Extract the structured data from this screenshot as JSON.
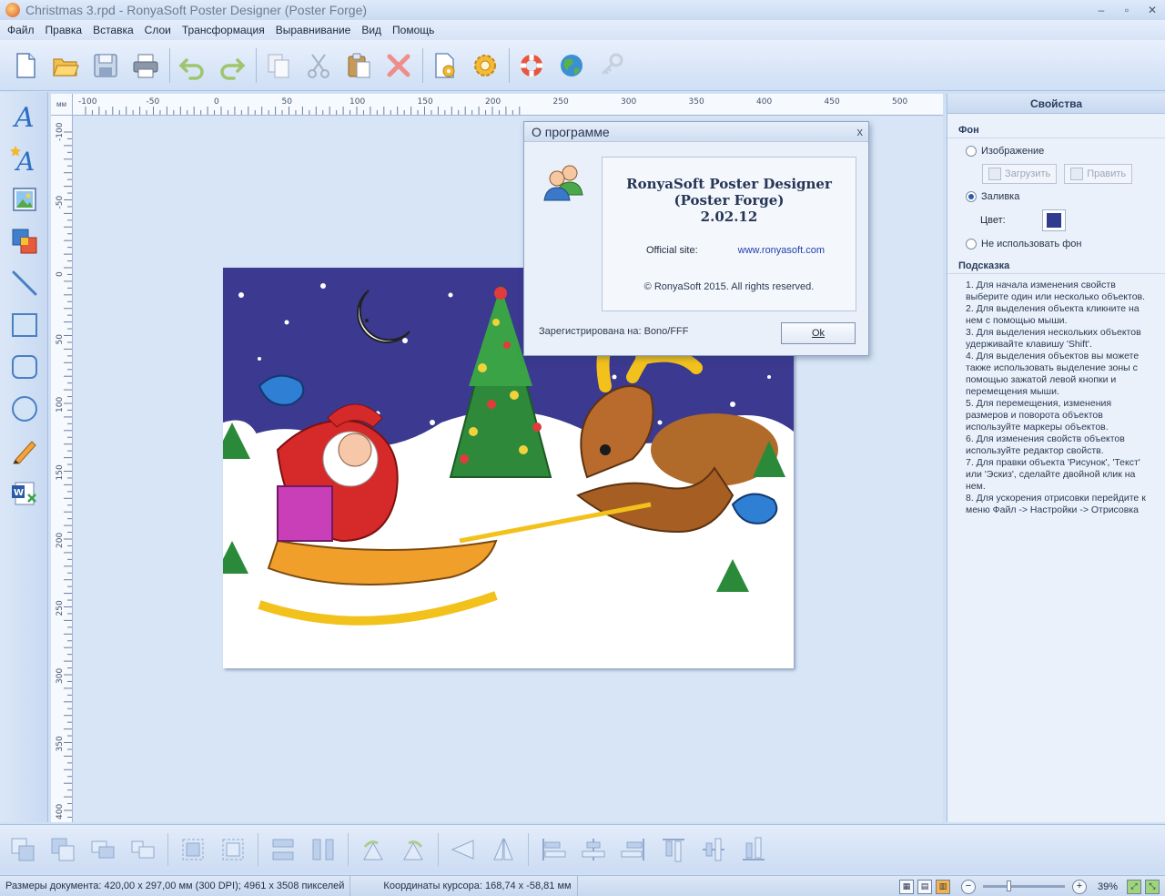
{
  "window": {
    "title": "Christmas 3.rpd - RonyaSoft Poster Designer (Poster Forge)",
    "min_glyph": "–",
    "max_glyph": "▫",
    "close_glyph": "✕"
  },
  "menu": [
    "Файл",
    "Правка",
    "Вставка",
    "Слои",
    "Трансформация",
    "Выравнивание",
    "Вид",
    "Помощь"
  ],
  "toolbar_icons": [
    "new-document-icon",
    "open-folder-icon",
    "save-icon",
    "print-icon",
    "undo-icon",
    "redo-icon",
    "copy-icon",
    "cut-icon",
    "paste-icon",
    "delete-icon",
    "page-settings-icon",
    "settings-gear-icon",
    "help-lifebuoy-icon",
    "website-globe-icon",
    "register-key-icon"
  ],
  "left_tools": [
    "text-icon",
    "curved-text-icon",
    "image-icon",
    "clipart-icon",
    "line-icon",
    "rectangle-icon",
    "rounded-rectangle-icon",
    "ellipse-icon",
    "pencil-icon",
    "word-document-icon"
  ],
  "ruler": {
    "unit": "мм",
    "top_labels": [
      "-100",
      "-50",
      "0",
      "50",
      "100",
      "150",
      "200",
      "250",
      "300",
      "350",
      "400",
      "450",
      "500"
    ],
    "left_labels": [
      "-100",
      "-50",
      "0",
      "50",
      "100",
      "150",
      "200",
      "250",
      "300",
      "350",
      "400"
    ]
  },
  "properties": {
    "header": "Свойства",
    "background_section": "Фон",
    "option_image": "Изображение",
    "btn_load": "Загрузить",
    "btn_edit": "Править",
    "option_fill": "Заливка",
    "color_label": "Цвет:",
    "fill_color": "#2f3b8f",
    "option_none": "Не использовать фон",
    "hint_section": "Подсказка",
    "hints": [
      "1. Для начала изменения свойств выберите один или несколько объектов.",
      "2. Для выделения объекта кликните на нем с помощью мыши.",
      "3. Для выделения нескольких объектов удерживайте клавишу 'Shift'.",
      "4. Для выделения объектов вы можете также использовать выделение зоны с помощью зажатой левой кнопки и перемещения мыши.",
      "5. Для перемещения, изменения размеров и поворота объектов используйте маркеры объектов.",
      "6. Для изменения свойств объектов используйте редактор свойств.",
      "7. Для правки объекта 'Рисунок', 'Текст' или 'Эскиз', сделайте двойной клик на нем.",
      "8. Для ускорения отрисовки перейдите к меню Файл -> Настройки -> Отрисовка"
    ]
  },
  "about": {
    "title": "О программе",
    "close": "x",
    "product_line1": "RonyaSoft Poster Designer",
    "product_line2": "(Poster Forge)",
    "version": "2.02.12",
    "site_label": "Official site:",
    "site_url": "www.ronyasoft.com",
    "copyright": "© RonyaSoft 2015. All rights reserved.",
    "registered": "Зарегистрирована на: Bono/FFF",
    "ok": "Ok"
  },
  "status": {
    "doc_size": "Размеры документа: 420,00 x 297,00 мм (300 DPI); 4961 x 3508 пикселей",
    "cursor": "Координаты курсора: 168,74 x -58,81 мм",
    "zoom": "39%",
    "zoom_minus": "−",
    "zoom_plus": "+"
  },
  "colors": {
    "sky": "#3b3990",
    "snow": "#ffffff"
  }
}
